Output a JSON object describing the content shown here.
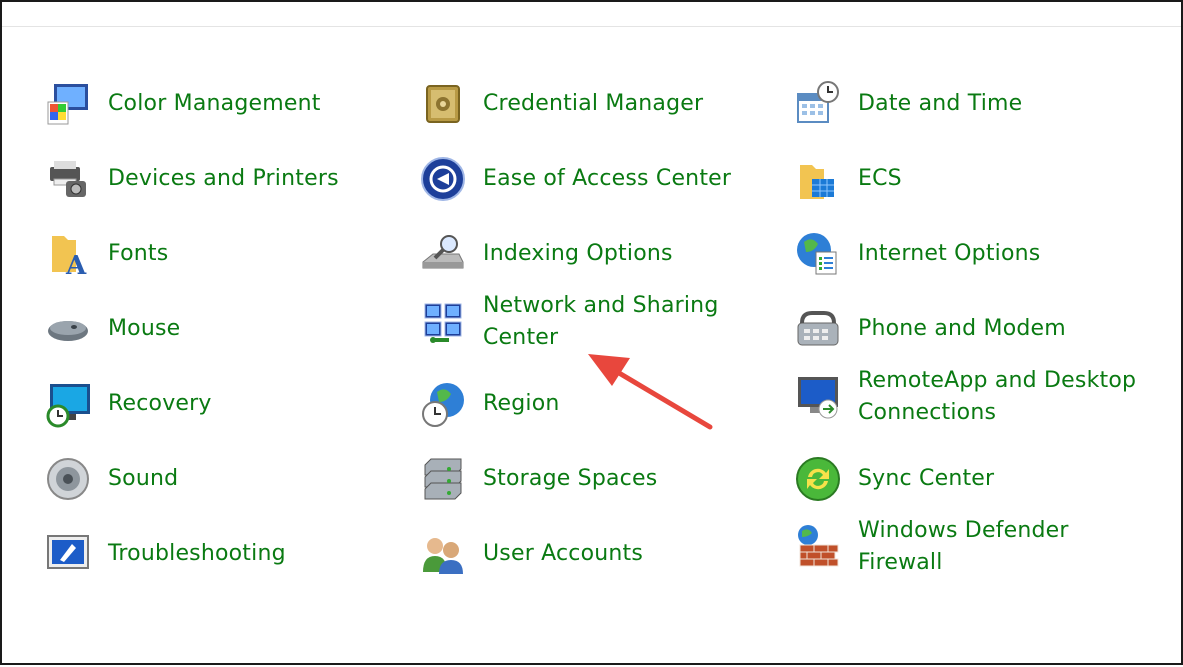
{
  "control_panel": {
    "items": [
      {
        "label": "Color Management",
        "icon": "color-management-icon"
      },
      {
        "label": "Credential Manager",
        "icon": "credential-manager-icon"
      },
      {
        "label": "Date and Time",
        "icon": "date-and-time-icon"
      },
      {
        "label": "Devices and Printers",
        "icon": "devices-and-printers-icon"
      },
      {
        "label": "Ease of Access Center",
        "icon": "ease-of-access-icon"
      },
      {
        "label": "ECS",
        "icon": "folder-ecs-icon"
      },
      {
        "label": "Fonts",
        "icon": "fonts-icon"
      },
      {
        "label": "Indexing Options",
        "icon": "indexing-options-icon"
      },
      {
        "label": "Internet Options",
        "icon": "internet-options-icon"
      },
      {
        "label": "Mouse",
        "icon": "mouse-icon"
      },
      {
        "label": "Network and Sharing Center",
        "icon": "network-sharing-icon"
      },
      {
        "label": "Phone and Modem",
        "icon": "phone-modem-icon"
      },
      {
        "label": "Recovery",
        "icon": "recovery-icon"
      },
      {
        "label": "Region",
        "icon": "region-icon"
      },
      {
        "label": "RemoteApp and Desktop Connections",
        "icon": "remoteapp-icon"
      },
      {
        "label": "Sound",
        "icon": "sound-icon"
      },
      {
        "label": "Storage Spaces",
        "icon": "storage-spaces-icon"
      },
      {
        "label": "Sync Center",
        "icon": "sync-center-icon"
      },
      {
        "label": "Troubleshooting",
        "icon": "troubleshooting-icon"
      },
      {
        "label": "User Accounts",
        "icon": "user-accounts-icon"
      },
      {
        "label": "Windows Defender Firewall",
        "icon": "firewall-icon"
      }
    ]
  },
  "colors": {
    "link_text": "#0a7a12",
    "annotation_arrow": "#e8473d"
  }
}
